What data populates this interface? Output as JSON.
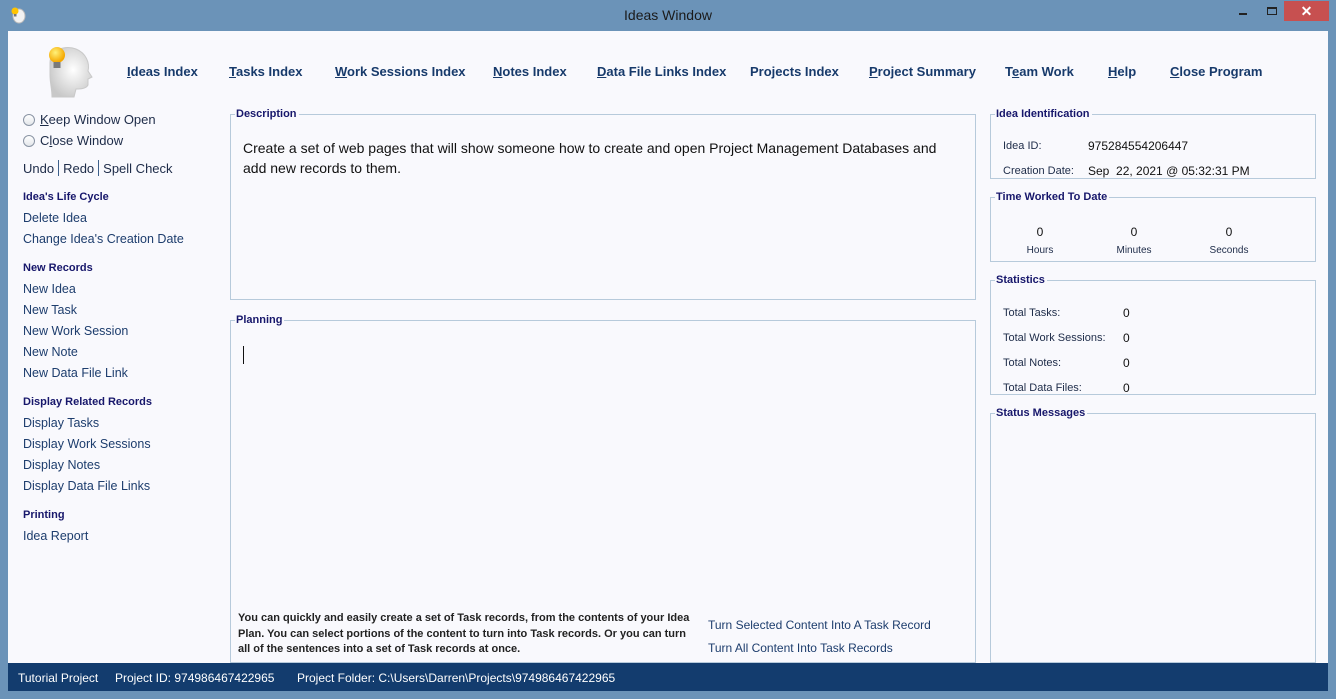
{
  "window": {
    "title": "Ideas Window",
    "controls": {
      "minimize": "minimize",
      "maximize": "maximize",
      "close": "✕"
    }
  },
  "topnav": [
    {
      "key": "I",
      "rest": "deas Index"
    },
    {
      "key": "T",
      "rest": "asks Index"
    },
    {
      "key": "W",
      "rest": "ork Sessions Index"
    },
    {
      "key": "N",
      "rest": "otes Index"
    },
    {
      "key": "D",
      "rest": "ata File Links Index"
    },
    {
      "key": "",
      "rest": "Projects Index"
    },
    {
      "key": "P",
      "rest": "roject Summary"
    },
    {
      "pre": "T",
      "key": "e",
      "rest": "am Work"
    },
    {
      "key": "H",
      "rest": "elp"
    },
    {
      "key": "C",
      "rest": "lose Program"
    }
  ],
  "sidebar": {
    "window_options": [
      {
        "pre": "",
        "key": "K",
        "rest": "eep Window Open"
      },
      {
        "pre": "C",
        "key": "l",
        "rest": "ose Window"
      }
    ],
    "edit": {
      "undo": "Undo",
      "redo": "Redo",
      "spell": "Spell Check"
    },
    "sections": [
      {
        "heading": "Idea's Life Cycle",
        "items": [
          "Delete Idea",
          "Change Idea's Creation Date"
        ]
      },
      {
        "heading": "New Records",
        "items": [
          "New Idea",
          "New Task",
          "New Work Session",
          "New Note",
          "New Data File Link"
        ]
      },
      {
        "heading": "Display Related Records",
        "items": [
          "Display Tasks",
          "Display Work Sessions",
          "Display Notes",
          "Display Data File Links"
        ]
      },
      {
        "heading": "Printing",
        "items": [
          "Idea Report"
        ]
      }
    ]
  },
  "description": {
    "legend": "Description",
    "text": "Create a set of web pages that will show someone how to create and open Project Management Databases and add new records to them."
  },
  "planning": {
    "legend": "Planning",
    "text": "",
    "help": "You can quickly and easily create a set of Task records, from the contents of your Idea Plan. You can select portions of the content to turn into Task records. Or you can turn all of the sentences into a set of Task records at once.",
    "actions": [
      "Turn Selected Content Into A Task Record",
      "Turn All Content Into Task Records"
    ]
  },
  "identification": {
    "legend": "Idea Identification",
    "id_label": "Idea ID:",
    "id_value": "975284554206447",
    "date_label": "Creation Date:",
    "date_value": "Sep  22, 2021 @ 05:32:31 PM"
  },
  "time_worked": {
    "legend": "Time Worked To Date",
    "hours": "0",
    "hours_label": "Hours",
    "minutes": "0",
    "minutes_label": "Minutes",
    "seconds": "0",
    "seconds_label": "Seconds"
  },
  "statistics": {
    "legend": "Statistics",
    "rows": [
      {
        "label": "Total Tasks:",
        "value": "0"
      },
      {
        "label": "Total Work Sessions:",
        "value": "0"
      },
      {
        "label": "Total Notes:",
        "value": "0"
      },
      {
        "label": "Total Data Files:",
        "value": "0"
      }
    ]
  },
  "status_messages": {
    "legend": "Status Messages",
    "text": ""
  },
  "statusbar": {
    "project_name": "Tutorial Project",
    "project_id": "Project ID:  974986467422965",
    "project_folder": "Project Folder: C:\\Users\\Darren\\Projects\\974986467422965"
  }
}
